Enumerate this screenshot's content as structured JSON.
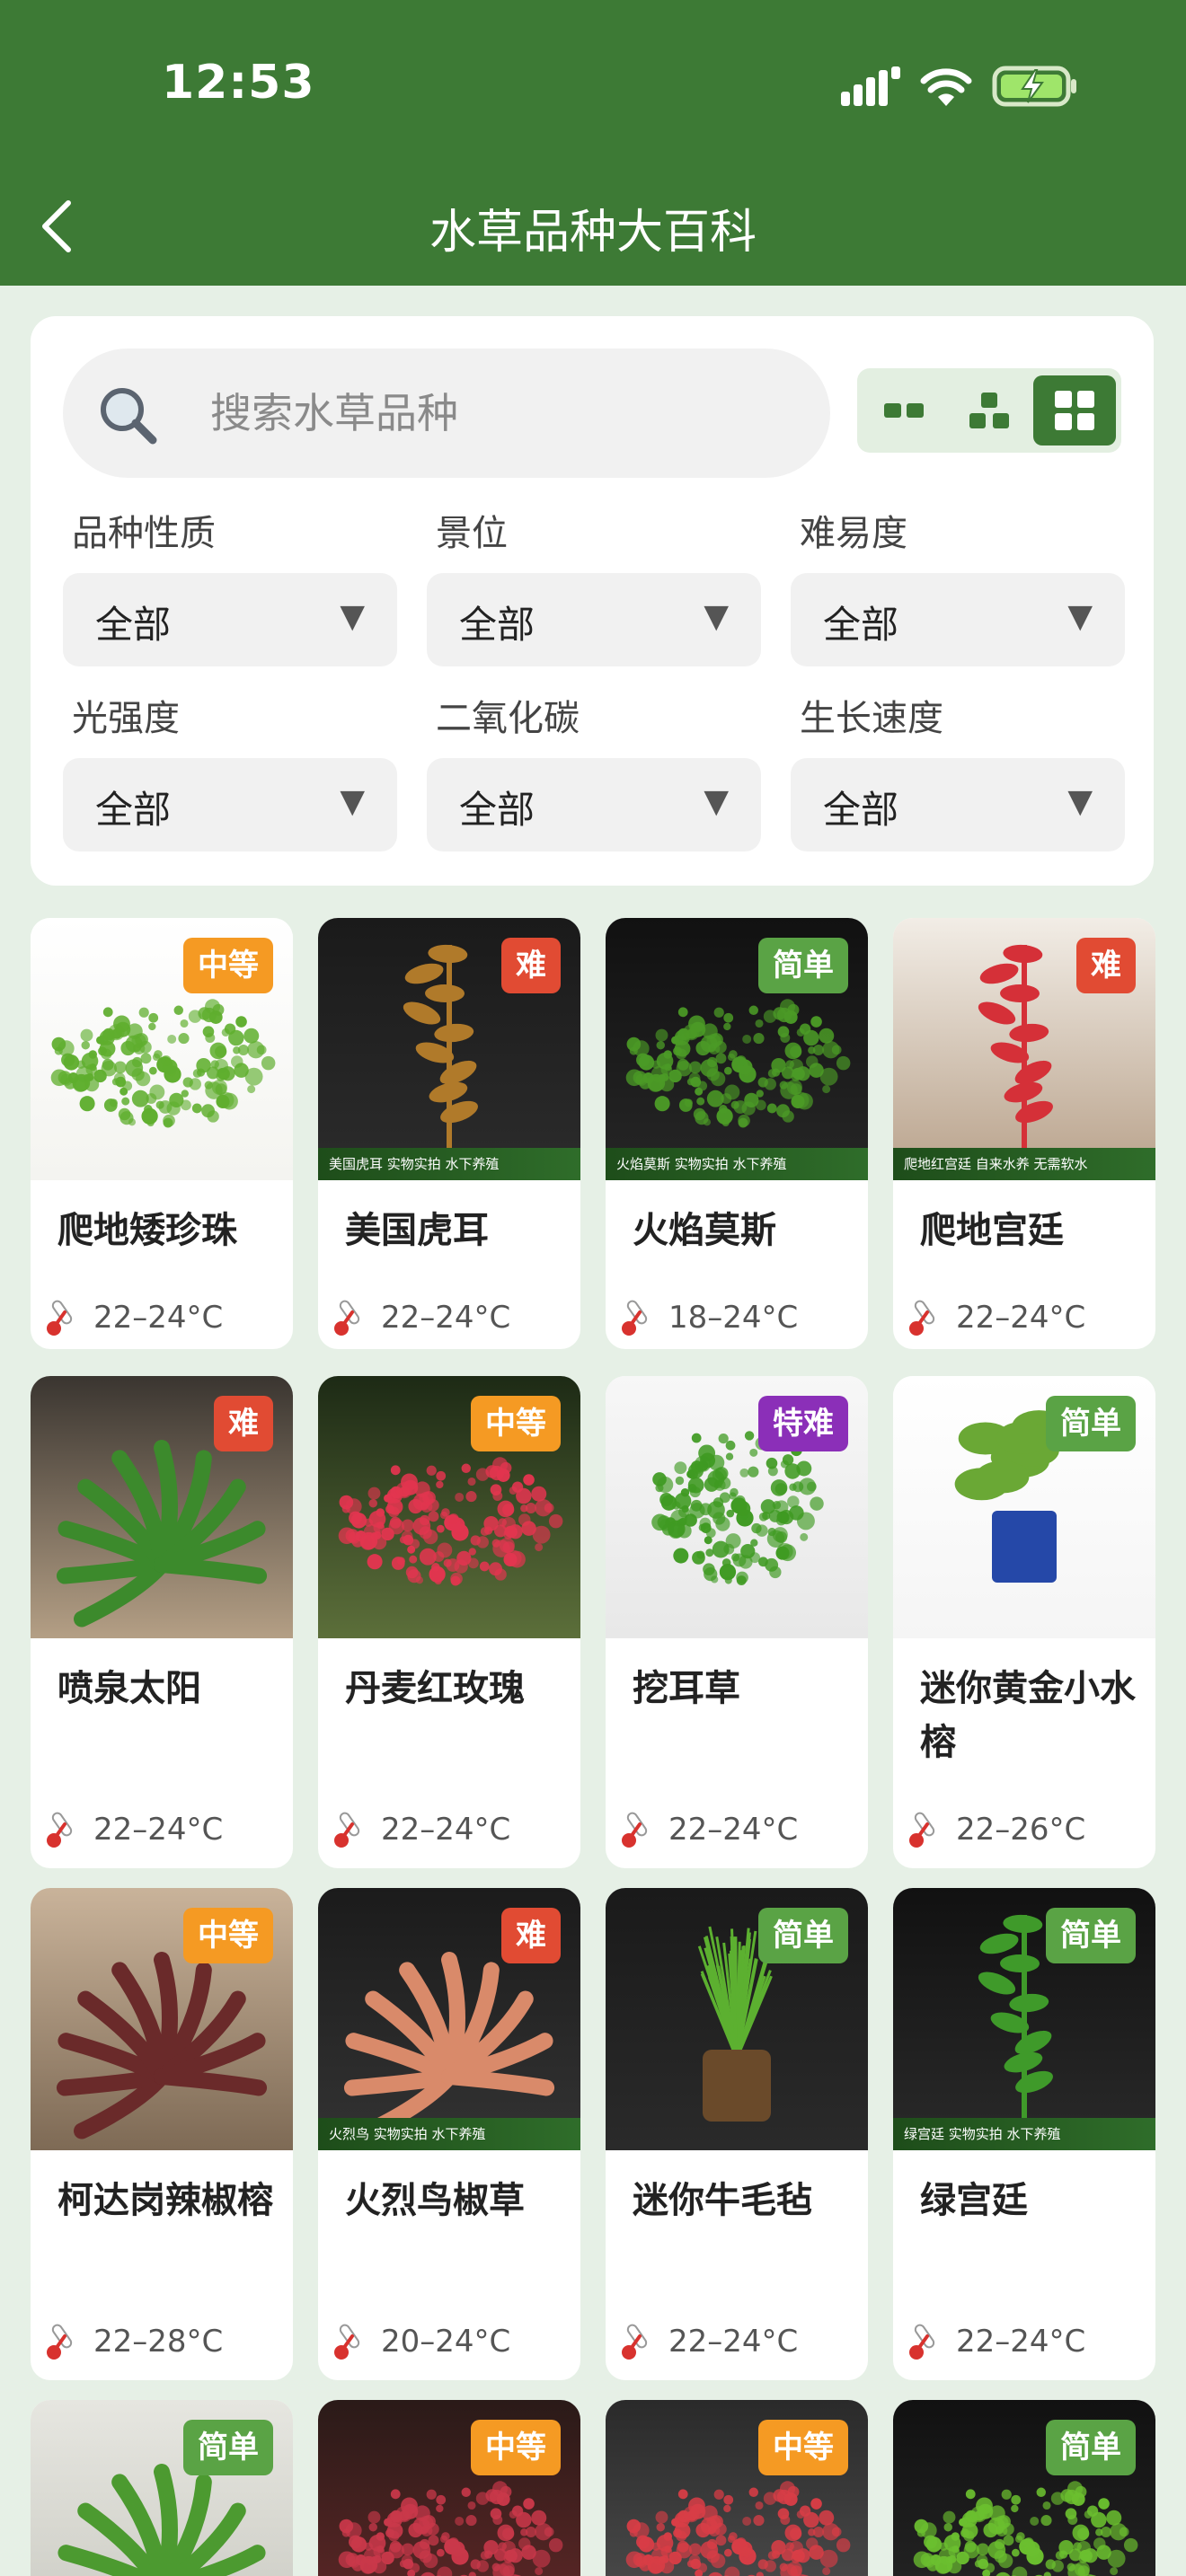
{
  "status_bar": {
    "time": "12:53"
  },
  "header": {
    "title": "水草品种大百科"
  },
  "search": {
    "placeholder": "搜索水草品种"
  },
  "filters": [
    {
      "label": "品种性质",
      "value": "全部"
    },
    {
      "label": "景位",
      "value": "全部"
    },
    {
      "label": "难易度",
      "value": "全部"
    },
    {
      "label": "光强度",
      "value": "全部"
    },
    {
      "label": "二氧化碳",
      "value": "全部"
    },
    {
      "label": "生长速度",
      "value": "全部"
    }
  ],
  "difficulty_colors": {
    "中等": "#f59a23",
    "难": "#e14b33",
    "简单": "#5aa345",
    "特难": "#8b2fb8"
  },
  "plants": [
    {
      "name": "爬地矮珍珠",
      "temp": "22–24°C",
      "difficulty": "中等",
      "caption": ""
    },
    {
      "name": "美国虎耳",
      "temp": "22–24°C",
      "difficulty": "难",
      "caption": "美国虎耳  实物实拍 水下养殖"
    },
    {
      "name": "火焰莫斯",
      "temp": "18–24°C",
      "difficulty": "简单",
      "caption": "火焰莫斯  实物实拍 水下养殖"
    },
    {
      "name": "爬地宫廷",
      "temp": "22–24°C",
      "difficulty": "难",
      "caption": "爬地红宫廷  自来水养 无需软水"
    },
    {
      "name": "喷泉太阳",
      "temp": "22–24°C",
      "difficulty": "难",
      "caption": ""
    },
    {
      "name": "丹麦红玫瑰",
      "temp": "22–24°C",
      "difficulty": "中等",
      "caption": ""
    },
    {
      "name": "挖耳草",
      "temp": "22–24°C",
      "difficulty": "特难",
      "caption": ""
    },
    {
      "name": "迷你黄金小水榕",
      "temp": "22–26°C",
      "difficulty": "简单",
      "caption": ""
    },
    {
      "name": "柯达岗辣椒榕",
      "temp": "22–28°C",
      "difficulty": "中等",
      "caption": ""
    },
    {
      "name": "火烈鸟椒草",
      "temp": "20–24°C",
      "difficulty": "难",
      "caption": "火烈鸟  实物实拍 水下养殖"
    },
    {
      "name": "迷你牛毛毡",
      "temp": "22–24°C",
      "difficulty": "简单",
      "caption": ""
    },
    {
      "name": "绿宫廷",
      "temp": "22–24°C",
      "difficulty": "简单",
      "caption": "绿宫廷  实物实拍 水下养殖"
    },
    {
      "name": "",
      "temp": "",
      "difficulty": "简单",
      "caption": ""
    },
    {
      "name": "",
      "temp": "",
      "difficulty": "中等",
      "caption": ""
    },
    {
      "name": "",
      "temp": "",
      "difficulty": "中等",
      "caption": ""
    },
    {
      "name": "",
      "temp": "",
      "difficulty": "简单",
      "caption": ""
    }
  ]
}
